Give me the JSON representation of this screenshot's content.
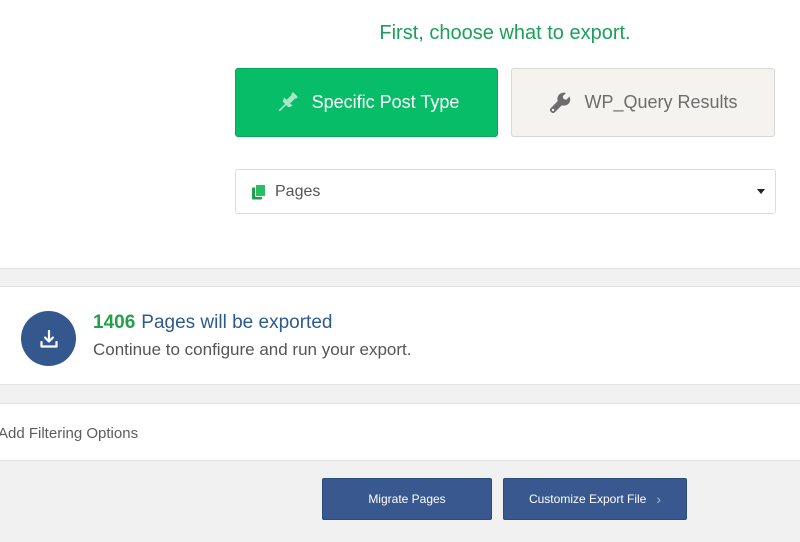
{
  "heading": "First, choose what to export.",
  "export_types": {
    "specific": {
      "label": "Specific Post Type",
      "icon": "pin-icon"
    },
    "wpquery": {
      "label": "WP_Query Results",
      "icon": "wrench-icon"
    }
  },
  "post_type_select": {
    "selected": "Pages",
    "icon": "pages-icon"
  },
  "summary": {
    "count": "1406",
    "text": "Pages will be exported",
    "subtext": "Continue to configure and run your export.",
    "icon": "download-icon"
  },
  "filtering": {
    "label": "Add Filtering Options"
  },
  "footer": {
    "migrate_label": "Migrate Pages",
    "customize_label": "Customize Export File",
    "customize_icon": "chevron-right-icon"
  },
  "colors": {
    "accent_green": "#08bd68",
    "heading_green": "#1aa05a",
    "primary_blue": "#38588f",
    "count_green": "#22a04b"
  }
}
